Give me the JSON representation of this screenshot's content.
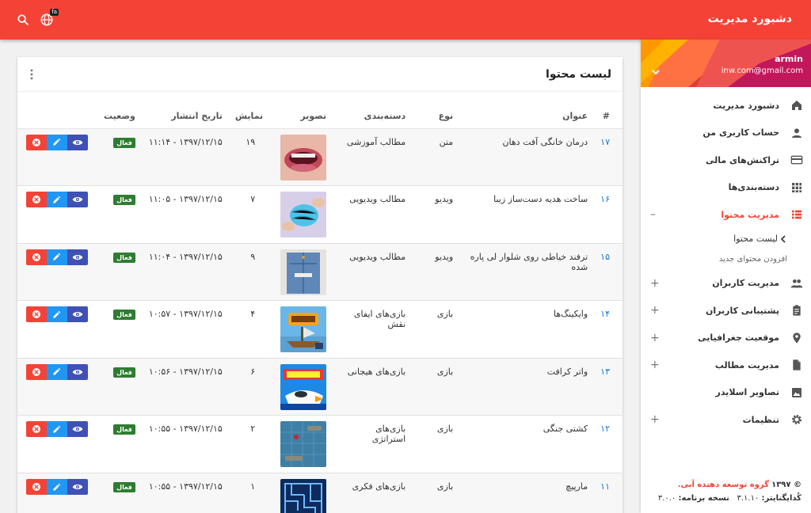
{
  "header": {
    "title": "دشبورد مدیریت",
    "lang_badge": "fa"
  },
  "user": {
    "name": "armin",
    "email": "inw.com@gmail.com"
  },
  "sidebar": {
    "items": [
      {
        "label": "دشبورد مدیریت",
        "icon": "home-icon",
        "expandable": false
      },
      {
        "label": "حساب کاربری من",
        "icon": "person-icon",
        "expandable": false
      },
      {
        "label": "تراکنش‌های مالی",
        "icon": "credit-card-icon",
        "expandable": false
      },
      {
        "label": "دسته‌بندی‌ها",
        "icon": "apps-grid-icon",
        "expandable": false
      },
      {
        "label": "مدیریت محتوا",
        "icon": "list-icon",
        "expandable": true,
        "active": true
      },
      {
        "label": "مدیریت کاربران",
        "icon": "people-icon",
        "expandable": true
      },
      {
        "label": "پشتیبانی کاربران",
        "icon": "clipboard-icon",
        "expandable": true
      },
      {
        "label": "موقعیت جغرافیایی",
        "icon": "location-pin-icon",
        "expandable": true
      },
      {
        "label": "مدیریت مطالب",
        "icon": "document-icon",
        "expandable": true
      },
      {
        "label": "تصاویر اسلایدر",
        "icon": "image-icon",
        "expandable": false
      },
      {
        "label": "تنظیمات",
        "icon": "settings-icon",
        "expandable": true
      }
    ],
    "sub_items": [
      {
        "label": "لیست محتوا",
        "current": true
      },
      {
        "label": "افزودن محتوای جدید",
        "current": false
      }
    ],
    "collapse_symbol": "–",
    "expand_symbol": "+"
  },
  "footer": {
    "copyright": "© ۱۳۹۷",
    "company": "گروه توسعه دهنده آبی.",
    "code_label": "کُدایگنایتر:",
    "code_version": "۳.۱.۱۰",
    "app_version_label": "نسخه برنامه:",
    "app_version": "۳.۰.۰"
  },
  "card": {
    "title": "لیست محتوا",
    "columns": [
      "#",
      "عنوان",
      "نوع",
      "دسته‌بندی",
      "تصویر",
      "نمایش",
      "تاریخ انتشار",
      "وضعیت"
    ]
  },
  "rows": [
    {
      "num": "۱۷",
      "title": "درمان خانگی آفت دهان",
      "type": "متن",
      "category": "مطالب آموزشی",
      "views": "۱۹",
      "date": "۱۳۹۷/۱۲/۱۵ - ۱۱:۱۴",
      "status": "فعال",
      "thumb": "mouth"
    },
    {
      "num": "۱۶",
      "title": "ساخت هدیه دست‌ساز زیبا",
      "type": "ویدیو",
      "category": "مطالب ویدیویی",
      "views": "۷",
      "date": "۱۳۹۷/۱۲/۱۵ - ۱۱:۰۵",
      "status": "فعال",
      "thumb": "yarn"
    },
    {
      "num": "۱۵",
      "title": "ترفند خیاطی روی شلوار لی پاره شده",
      "type": "ویدیو",
      "category": "مطالب ویدیویی",
      "views": "۹",
      "date": "۱۳۹۷/۱۲/۱۵ - ۱۱:۰۴",
      "status": "فعال",
      "thumb": "jeans"
    },
    {
      "num": "۱۴",
      "title": "وایکینگ‌ها",
      "type": "بازی",
      "category": "بازی‌های ایفای نقش",
      "views": "۴",
      "date": "۱۳۹۷/۱۲/۱۵ - ۱۰:۵۷",
      "status": "فعال",
      "thumb": "viking"
    },
    {
      "num": "۱۳",
      "title": "واتر کرافت",
      "type": "بازی",
      "category": "بازی‌های هیجانی",
      "views": "۶",
      "date": "۱۳۹۷/۱۲/۱۵ - ۱۰:۵۶",
      "status": "فعال",
      "thumb": "watercraft"
    },
    {
      "num": "۱۲",
      "title": "کشتی جنگی",
      "type": "بازی",
      "category": "بازی‌های استراتژی",
      "views": "۲",
      "date": "۱۳۹۷/۱۲/۱۵ - ۱۰:۵۵",
      "status": "فعال",
      "thumb": "battleship"
    },
    {
      "num": "۱۱",
      "title": "مارپیچ",
      "type": "بازی",
      "category": "بازی‌های فکری",
      "views": "۱",
      "date": "۱۳۹۷/۱۲/۱۵ - ۱۰:۵۵",
      "status": "فعال",
      "thumb": "maze"
    }
  ],
  "colors": {
    "primary": "#f44336",
    "view": "#3f51b5",
    "edit": "#2196f3",
    "delete": "#f44336",
    "status": "#2e7d32",
    "link": "#1976d2"
  }
}
